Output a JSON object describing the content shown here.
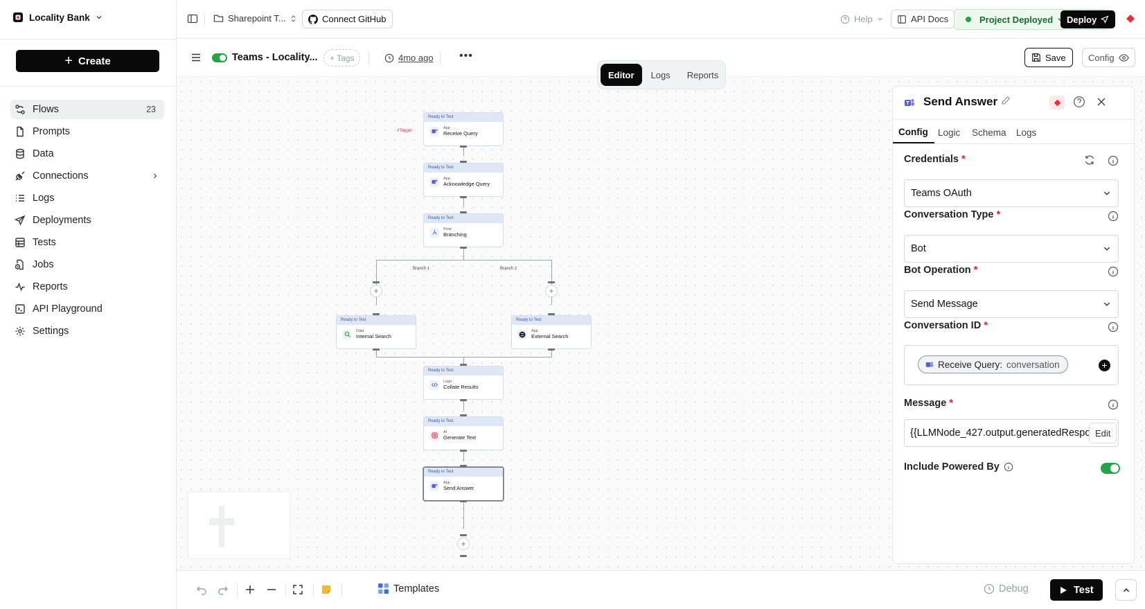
{
  "workspace": {
    "name": "Locality Bank"
  },
  "sidebar": {
    "create_label": "Create",
    "items": [
      {
        "label": "Flows",
        "count": "23"
      },
      {
        "label": "Prompts"
      },
      {
        "label": "Data"
      },
      {
        "label": "Connections"
      },
      {
        "label": "Logs"
      },
      {
        "label": "Deployments"
      },
      {
        "label": "Tests"
      },
      {
        "label": "Jobs"
      },
      {
        "label": "Reports"
      },
      {
        "label": "API Playground"
      },
      {
        "label": "Settings"
      }
    ]
  },
  "topbar": {
    "project": "Sharepoint T...",
    "github": "Connect GitHub",
    "help": "Help",
    "api_docs": "API Docs",
    "status": "Project Deployed",
    "deploy": "Deploy"
  },
  "subbar": {
    "flow_name": "Teams - Locality...",
    "tags": "+ Tags",
    "modified": "4mo ago",
    "save": "Save",
    "config": "Config"
  },
  "view_tabs": [
    "Editor",
    "Logs",
    "Reports"
  ],
  "canvas": {
    "trigger_label": "#Trigger",
    "branch_labels": [
      "Branch 1",
      "Branch 2"
    ],
    "nodes": [
      {
        "status": "Ready to Test",
        "kind": "App",
        "name": "Receive Query",
        "icon": "teams-icon"
      },
      {
        "status": "Ready to Test",
        "kind": "App",
        "name": "Acknowledge Query",
        "icon": "teams-icon"
      },
      {
        "status": "Ready to Test",
        "kind": "Flow",
        "name": "Branching",
        "icon": "branch-icon"
      },
      {
        "status": "Ready to Test",
        "kind": "Data",
        "name": "Internal Search",
        "icon": "search-icon"
      },
      {
        "status": "Ready to Test",
        "kind": "App",
        "name": "External Search",
        "icon": "globe-icon"
      },
      {
        "status": "Ready to Test",
        "kind": "Logic",
        "name": "Collate Results",
        "icon": "code-icon"
      },
      {
        "status": "Ready to Test",
        "kind": "AI",
        "name": "Generate Text",
        "icon": "ai-icon"
      },
      {
        "status": "Ready to Test",
        "kind": "App",
        "name": "Send Answer",
        "icon": "teams-icon"
      }
    ]
  },
  "panel": {
    "title": "Send Answer",
    "tabs": [
      "Config",
      "Logic",
      "Schema",
      "Logs"
    ],
    "fields": {
      "credentials": {
        "label": "Credentials",
        "value": "Teams OAuth"
      },
      "conversation_type": {
        "label": "Conversation Type",
        "value": "Bot"
      },
      "bot_operation": {
        "label": "Bot Operation",
        "value": "Send Message"
      },
      "conversation_id": {
        "label": "Conversation ID",
        "chip_source": "Receive Query:",
        "chip_field": "conversation"
      },
      "message": {
        "label": "Message",
        "value": "{{LLMNode_427.output.generatedRespo",
        "edit": "Edit"
      },
      "powered_by": {
        "label": "Include Powered By",
        "enabled": true
      }
    }
  },
  "bottombar": {
    "templates": "Templates",
    "debug": "Debug",
    "test": "Test"
  },
  "colors": {
    "accent_green": "#22a447",
    "brand_red": "#ef2b3a",
    "teams_purple": "#5b5fc7"
  }
}
